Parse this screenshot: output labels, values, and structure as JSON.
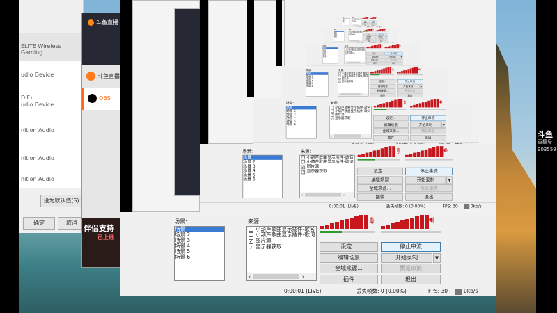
{
  "settings": {
    "devices": [
      "ELITE Wireless Gaming",
      "udio Device",
      "DIF)",
      "udio Device",
      "nition Audio",
      "nition Audio",
      "nition Audio"
    ],
    "set_default": "设为默认值(S)",
    "ok": "确定",
    "cancel": "取消"
  },
  "douyu": {
    "title": "斗鱼直播",
    "items": [
      "斗鱼直播",
      "OBS"
    ],
    "ad_title": "伴侣支持",
    "ad_sub": "已上线"
  },
  "obs": {
    "scenes_label": "场景:",
    "scenes": [
      "场景",
      "场景 2",
      "场景 3",
      "场景 4",
      "场景 5",
      "场景 6"
    ],
    "sources_label": "来源:",
    "sources": [
      {
        "name": "小葫芦歌曲显示插件-歌名",
        "checked": false
      },
      {
        "name": "小葫芦歌曲显示插件-歌词",
        "checked": false
      },
      {
        "name": "图片源",
        "checked": true
      },
      {
        "name": "显示器获取",
        "checked": true
      }
    ],
    "buttons": {
      "settings": "设定...",
      "stop_stream": "停止串流",
      "edit_scene": "编辑场景",
      "start_record": "开始录制",
      "global_sources": "全域来源...",
      "preview_stream": "预览串流",
      "plugins": "插件",
      "exit": "退出"
    },
    "status": {
      "time": "0:00:01 (LIVE)",
      "dropped": "丢失帧数: 0 (0.00%)",
      "fps": "FPS: 30",
      "bitrate": "0kb/s"
    },
    "meter_levels": [
      0.2,
      0.3,
      0.4,
      0.5,
      0.6,
      0.7,
      0.8,
      0.9,
      1.0,
      1.0
    ],
    "mic_level": 0.4
  },
  "brand": {
    "name": "斗鱼",
    "sub": "直播号",
    "room": "903559"
  },
  "colors": {
    "accent": "#ff6a1a",
    "meter": "#c8161d",
    "selection": "#3a7bd5"
  }
}
